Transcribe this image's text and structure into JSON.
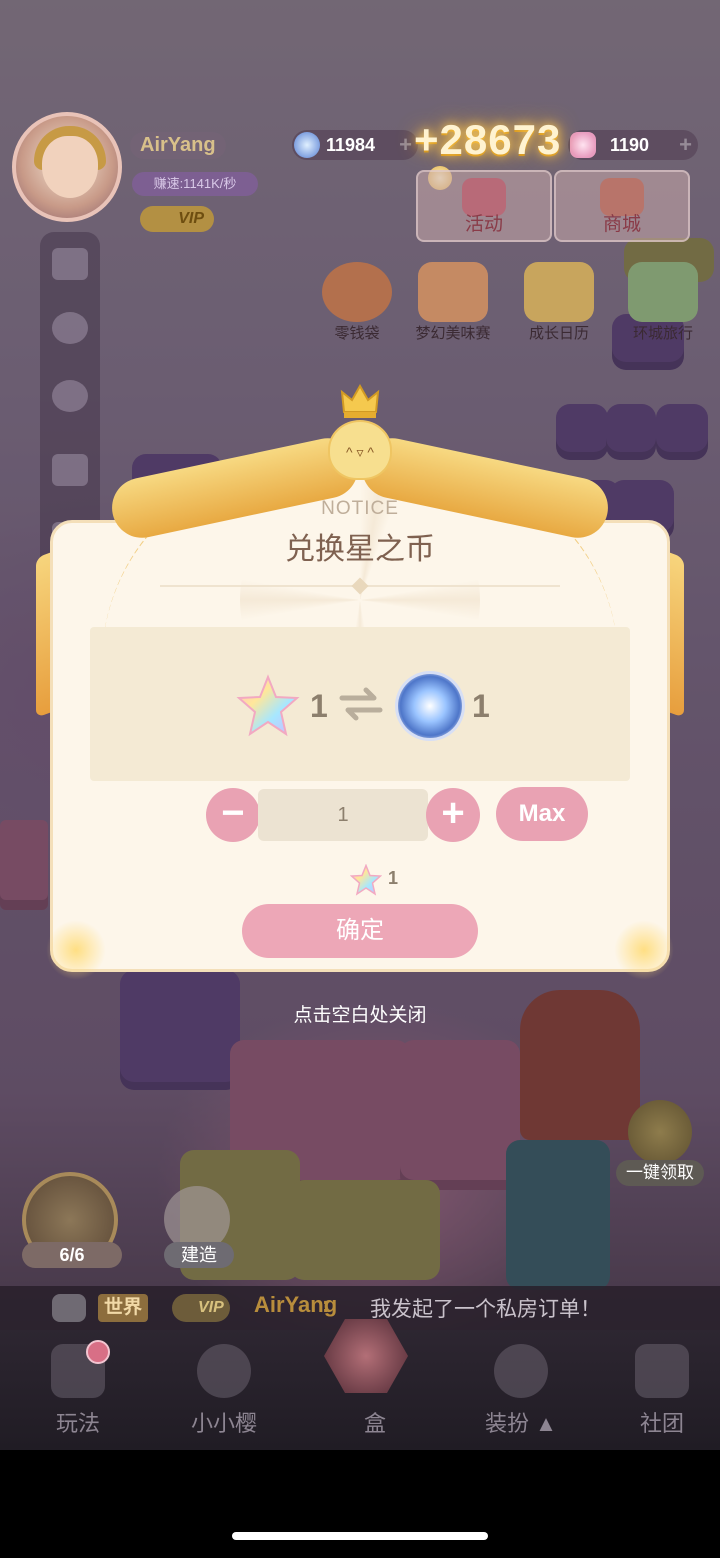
{
  "player": {
    "name": "AirYang",
    "speed": "赚速:1141K/秒",
    "vip": "VIP"
  },
  "currency": {
    "silver": "11984",
    "star": "1190",
    "float_gain": "+28673"
  },
  "top_buttons": {
    "event": "活动",
    "shop": "商城"
  },
  "activities": [
    {
      "label": "零钱袋"
    },
    {
      "label": "梦幻美味赛"
    },
    {
      "label": "成长日历"
    },
    {
      "label": "环城旅行"
    }
  ],
  "dialog": {
    "notice": "NOTICE",
    "title": "兑换星之币",
    "from_amount": "1",
    "to_amount": "1",
    "quantity": "1",
    "max_label": "Max",
    "minus": "−",
    "plus": "+",
    "cost": "1",
    "confirm": "确定",
    "close_hint": "点击空白处关闭"
  },
  "side": {
    "gift_count": "6/6",
    "build": "建造",
    "claim_all": "一键领取"
  },
  "chat": {
    "channel": "世界",
    "vip": "VIP",
    "user": "AirYang",
    "colon": ":",
    "message": "我发起了一个私房订单！"
  },
  "nav": {
    "play": "玩法",
    "sakura": "小小樱",
    "center": "盒",
    "dress": "装扮 ▲",
    "club": "社团"
  },
  "colors": {
    "accent_pink": "#e9a2b3",
    "modal_bg": "#fdf6ea",
    "title_brown": "#7f6150"
  }
}
